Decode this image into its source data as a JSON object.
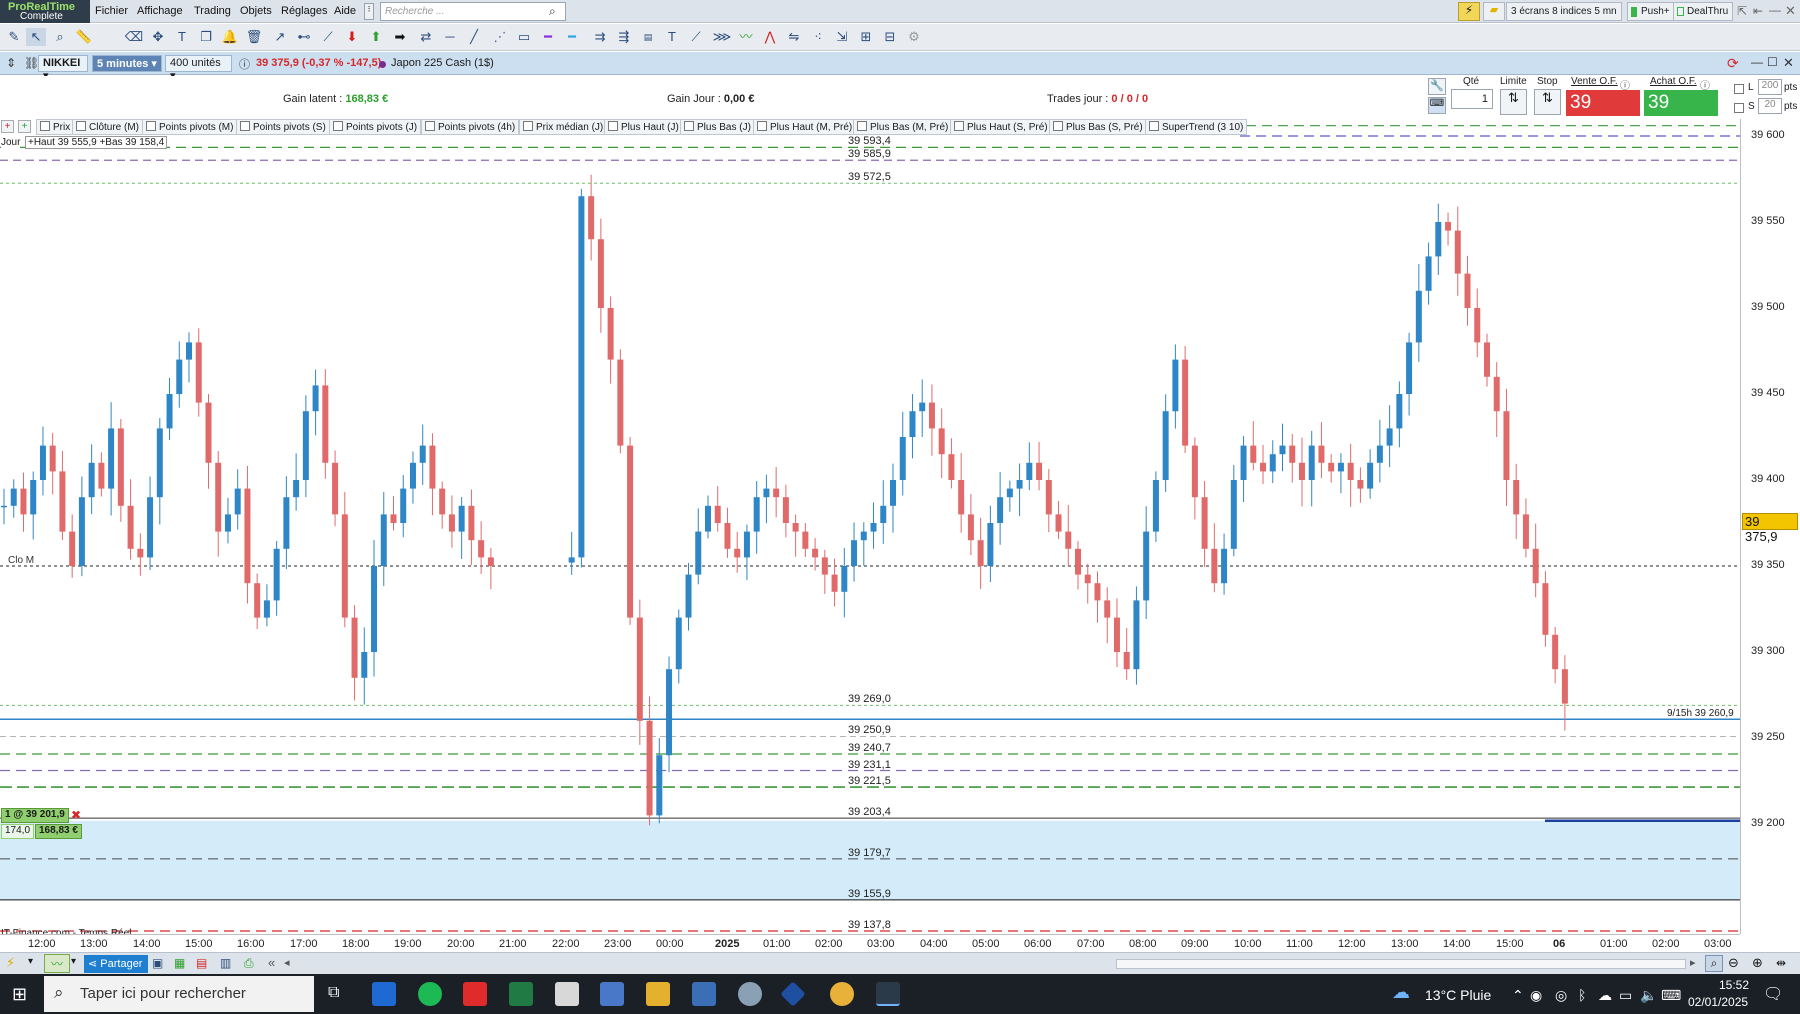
{
  "app": {
    "logo_line1": "ProRealTime",
    "logo_line2": "Complete"
  },
  "menu": {
    "items": [
      "Fichier",
      "Affichage",
      "Trading",
      "Objets",
      "Réglages",
      "Aide"
    ],
    "search_placeholder": "Recherche ...",
    "right_buttons": [
      "3 écrans 8 indices 5 mn",
      "Push+",
      "DealThru"
    ]
  },
  "chart_header": {
    "instrument": "NIKKEI",
    "timeframe": "5 minutes",
    "units": "400 unités",
    "quote": "39 375,9 (-0,37 % -147,5)",
    "market_name": "Japon 225 Cash (1$)"
  },
  "positions": {
    "gain_latent_label": "Gain latent :",
    "gain_latent_value": "168,83 €",
    "gain_jour_label": "Gain Jour :",
    "gain_jour_value": "0,00 €",
    "trades_jour_label": "Trades jour :",
    "trades_jour_value": "0 / 0 / 0"
  },
  "order_panel": {
    "qty_label": "Qté",
    "qty_value": "1",
    "limit_label": "Limite",
    "stop_label": "Stop",
    "sell_label": "Vente O.F.",
    "sell_price": "39 372,4",
    "buy_label": "Achat O.F.",
    "buy_price": "39 379,4",
    "l_label": "L",
    "l_value": "200",
    "s_label": "S",
    "s_value": "20",
    "pts": "pts"
  },
  "indicators": [
    "Prix",
    "Clôture (M)",
    "Points pivots (M)",
    "Points pivots (S)",
    "Points pivots (J)",
    "Points pivots (4h)",
    "Prix médian (J)",
    "Plus Haut (J)",
    "Plus Bas (J)",
    "Plus Haut (M, Pré)",
    "Plus Bas (M, Pré)",
    "Plus Haut (S, Pré)",
    "Plus Bas (S, Pré)",
    "SuperTrend (3 10)"
  ],
  "chart_overlays": {
    "day_label": "Jour",
    "day_info": "+Haut 39 555,9 +Bas 39 158,4",
    "clo_m_label": "Clo M",
    "position_tag": "1 @ 39 201,9",
    "position_qty": "174,0",
    "position_gain": "168,83 €",
    "source_label": "IT-Finance.com - Temps Réel",
    "right_level_label": "9/15h 39 260,9",
    "last_price_tag": "39 375,9"
  },
  "level_labels": [
    {
      "price": 39593.4,
      "text": "39 593,4"
    },
    {
      "price": 39585.9,
      "text": "39 585,9"
    },
    {
      "price": 39572.5,
      "text": "39 572,5"
    },
    {
      "price": 39269.0,
      "text": "39 269,0"
    },
    {
      "price": 39250.9,
      "text": "39 250,9"
    },
    {
      "price": 39240.7,
      "text": "39 240,7"
    },
    {
      "price": 39231.1,
      "text": "39 231,1"
    },
    {
      "price": 39221.5,
      "text": "39 221,5"
    },
    {
      "price": 39203.4,
      "text": "39 203,4"
    },
    {
      "price": 39179.7,
      "text": "39 179,7"
    },
    {
      "price": 39155.9,
      "text": "39 155,9"
    },
    {
      "price": 39137.8,
      "text": "39 137,8"
    }
  ],
  "y_ticks": [
    "39 600",
    "39 550",
    "39 500",
    "39 450",
    "39 400",
    "39 350",
    "39 300",
    "39 250",
    "39 200"
  ],
  "x_ticks": [
    "12:00",
    "13:00",
    "14:00",
    "15:00",
    "16:00",
    "17:00",
    "18:00",
    "19:00",
    "20:00",
    "21:00",
    "22:00",
    "23:00",
    "00:00",
    "2025",
    "01:00",
    "02:00",
    "03:00",
    "04:00",
    "05:00",
    "06:00",
    "07:00",
    "08:00",
    "09:00",
    "10:00",
    "11:00",
    "12:00",
    "13:00",
    "14:00",
    "15:00",
    "06",
    "01:00",
    "02:00",
    "03:00"
  ],
  "colors": {
    "up": "#2f86c6",
    "down": "#e06a6a",
    "position_zone": "#d4ecfa",
    "sell_bg": "#e03a3a",
    "buy_bg": "#38b54a"
  },
  "bottom_bar": {
    "share_label": "Partager"
  },
  "taskbar": {
    "search_text": "Taper ici pour rechercher",
    "weather": "13°C Pluie",
    "time": "15:52",
    "date": "02/01/2025"
  },
  "chart_data": {
    "type": "candlestick",
    "symbol": "NIKKEI",
    "interval": "5 minutes",
    "ylim": [
      39135,
      39610
    ],
    "y_ticks": [
      39600,
      39550,
      39500,
      39450,
      39400,
      39350,
      39300,
      39250,
      39200
    ],
    "close_series_approx": [
      39385,
      39395,
      39380,
      39400,
      39420,
      39405,
      39370,
      39350,
      39390,
      39410,
      39395,
      39430,
      39385,
      39360,
      39355,
      39390,
      39430,
      39450,
      39470,
      39480,
      39445,
      39410,
      39370,
      39380,
      39395,
      39340,
      39320,
      39330,
      39360,
      39390,
      39400,
      39440,
      39455,
      39410,
      39380,
      39320,
      39285,
      39300,
      39350,
      39380,
      39375,
      39395,
      39410,
      39420,
      39395,
      39380,
      39370,
      39385,
      39365,
      39355,
      39350,
      39355,
      39565,
      39540,
      39500,
      39470,
      39420,
      39320,
      39260,
      39205,
      39240,
      39290,
      39320,
      39345,
      39370,
      39385,
      39375,
      39360,
      39355,
      39370,
      39390,
      39395,
      39390,
      39375,
      39370,
      39360,
      39355,
      39345,
      39335,
      39350,
      39365,
      39370,
      39375,
      39385,
      39400,
      39425,
      39440,
      39445,
      39430,
      39415,
      39400,
      39380,
      39365,
      39350,
      39375,
      39390,
      39395,
      39400,
      39410,
      39400,
      39380,
      39370,
      39360,
      39345,
      39340,
      39330,
      39320,
      39300,
      39290,
      39330,
      39370,
      39400,
      39440,
      39470,
      39420,
      39390,
      39360,
      39340,
      39360,
      39400,
      39420,
      39410,
      39405,
      39415,
      39420,
      39410,
      39400,
      39420,
      39410,
      39405,
      39410,
      39400,
      39395,
      39410,
      39420,
      39430,
      39450,
      39480,
      39510,
      39530,
      39550,
      39545,
      39520,
      39500,
      39480,
      39460,
      39440,
      39400,
      39380,
      39360,
      39340,
      39310,
      39290,
      39270,
      39240,
      39200,
      39170,
      39200,
      39270,
      39320,
      39376
    ],
    "day_high": 39555.9,
    "day_low": 39158.4,
    "last": 39375.9,
    "close_m": 39350,
    "position_entry": 39201.9,
    "right_level": 39260.9,
    "horizontal_levels": [
      39593.4,
      39585.9,
      39572.5,
      39269.0,
      39260.9,
      39250.9,
      39240.7,
      39231.1,
      39221.5,
      39203.4,
      39179.7,
      39155.9,
      39137.8
    ]
  }
}
